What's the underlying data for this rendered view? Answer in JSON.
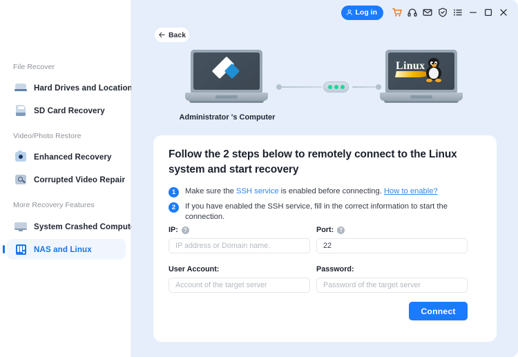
{
  "titlebar": {
    "login_label": "Log in",
    "icons": [
      {
        "name": "user-icon"
      },
      {
        "name": "cart-icon"
      },
      {
        "name": "headset-icon"
      },
      {
        "name": "mail-icon"
      },
      {
        "name": "shield-icon"
      },
      {
        "name": "menu-list-icon"
      },
      {
        "name": "minimize-icon"
      },
      {
        "name": "maximize-icon"
      },
      {
        "name": "close-icon"
      }
    ]
  },
  "back": {
    "label": "Back"
  },
  "sidebar": {
    "groups": [
      {
        "label": "File Recover",
        "items": [
          {
            "label": "Hard Drives and Locations",
            "icon": "hard-drive-icon",
            "active": false
          },
          {
            "label": "SD Card Recovery",
            "icon": "sd-card-icon",
            "active": false
          }
        ]
      },
      {
        "label": "Video/Photo Restore",
        "items": [
          {
            "label": "Enhanced Recovery",
            "icon": "camera-icon",
            "active": false
          },
          {
            "label": "Corrupted Video Repair",
            "icon": "video-repair-icon",
            "active": false
          }
        ]
      },
      {
        "label": "More Recovery Features",
        "items": [
          {
            "label": "System Crashed Computer",
            "icon": "monitor-icon",
            "active": false
          },
          {
            "label": "NAS and Linux",
            "icon": "nas-icon",
            "active": true
          }
        ]
      }
    ]
  },
  "illustration": {
    "local_caption": "Administrator 's Computer",
    "remote_logo_text": "Linux",
    "connection_status_dots": 3
  },
  "card": {
    "title": "Follow the 2 steps below to remotely connect to the Linux system and start recovery",
    "steps": [
      {
        "num": "1",
        "prefix": "Make sure the ",
        "highlight": "SSH service",
        "middle": " is enabled before connecting. ",
        "link": "How to enable?"
      },
      {
        "num": "2",
        "prefix": "If you have enabled the SSH service, fill in the correct information to start the connection.",
        "highlight": "",
        "middle": "",
        "link": ""
      }
    ],
    "fields": {
      "ip": {
        "label": "IP:",
        "value": "",
        "placeholder": "IP address or Domain name.",
        "help": "?"
      },
      "port": {
        "label": "Port:",
        "value": "22",
        "placeholder": "22",
        "help": "?"
      },
      "user": {
        "label": "User Account:",
        "value": "",
        "placeholder": "Account of the target server"
      },
      "password": {
        "label": "Password:",
        "value": "",
        "placeholder": "Password of the target server"
      }
    },
    "connect_label": "Connect"
  },
  "colors": {
    "accent": "#1a7bff",
    "panel_bg": "#e6eefb",
    "link": "#2f86f0",
    "cart": "#f4710f",
    "status_dot": "#19d89b"
  }
}
